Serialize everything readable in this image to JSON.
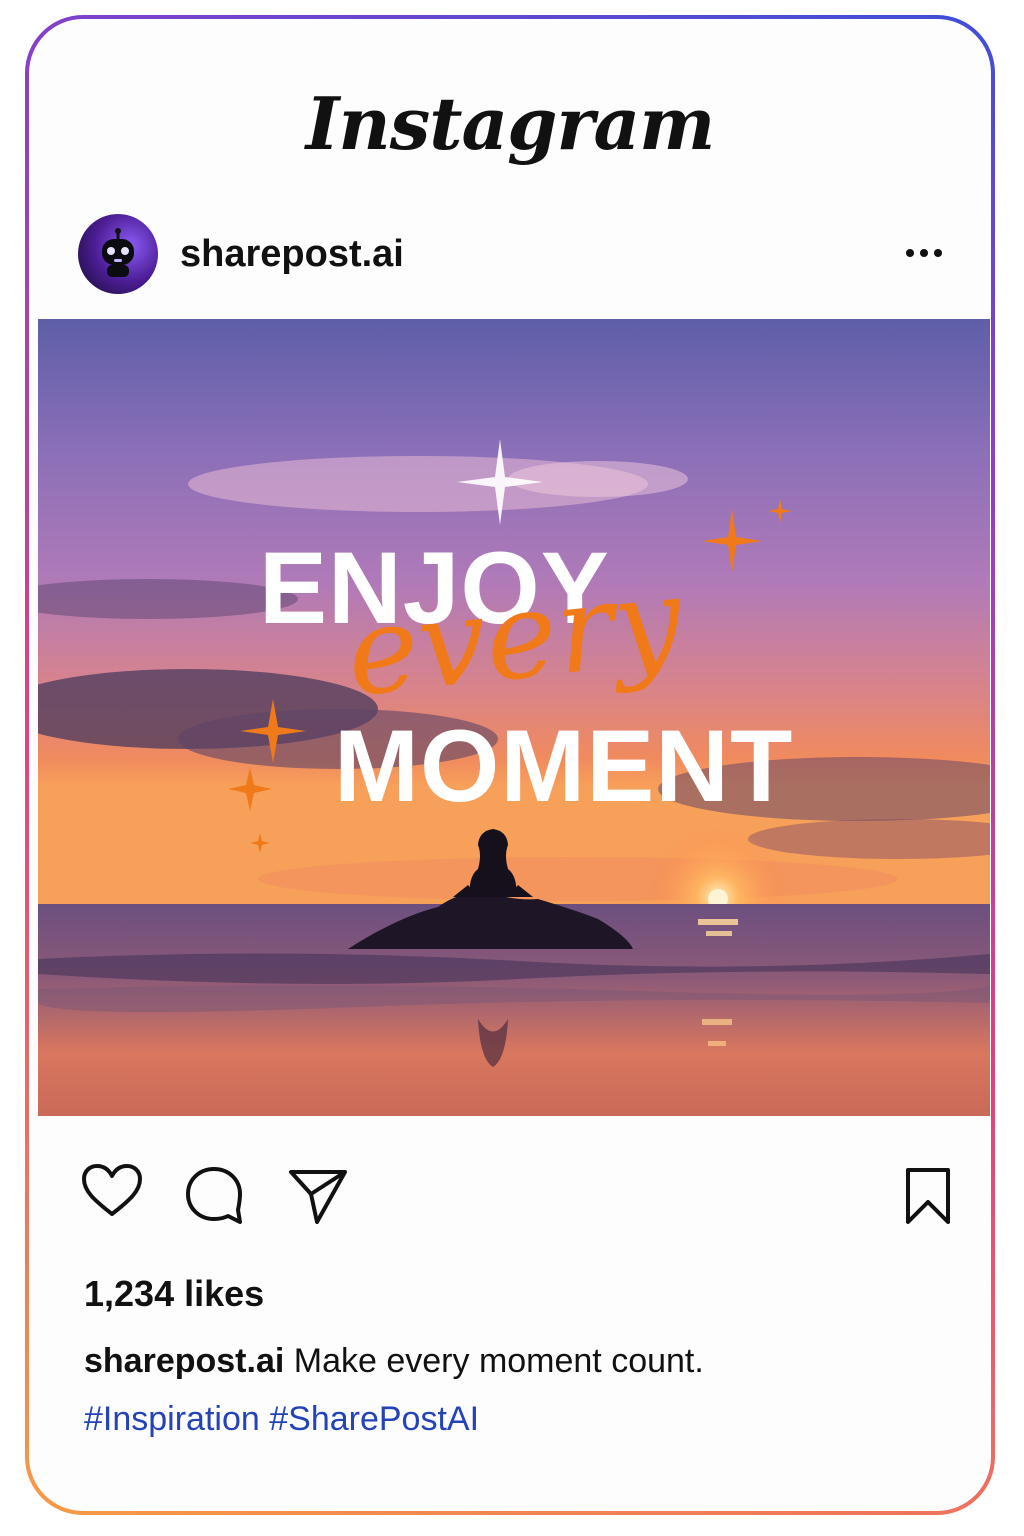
{
  "app": {
    "logo_text": "Instagram"
  },
  "post": {
    "username": "sharepost.ai",
    "image_text": {
      "line1": "ENJOY",
      "line2": "every",
      "line3": "MOMENT"
    },
    "likes": "1,234 likes",
    "caption": {
      "username": "sharepost.ai",
      "text": "Make every moment count."
    },
    "hashtags": [
      "#Inspiration",
      "#SharePostAI"
    ]
  },
  "icons": {
    "more": "more-options-icon",
    "like": "heart-icon",
    "comment": "comment-icon",
    "share": "send-icon",
    "save": "bookmark-icon"
  },
  "colors": {
    "border_gradient": [
      "#3f4fd8",
      "#8a3fc9",
      "#e2417e",
      "#f79a45"
    ],
    "accent_orange": "#f07a1a",
    "hashtag_blue": "#2443b8"
  }
}
